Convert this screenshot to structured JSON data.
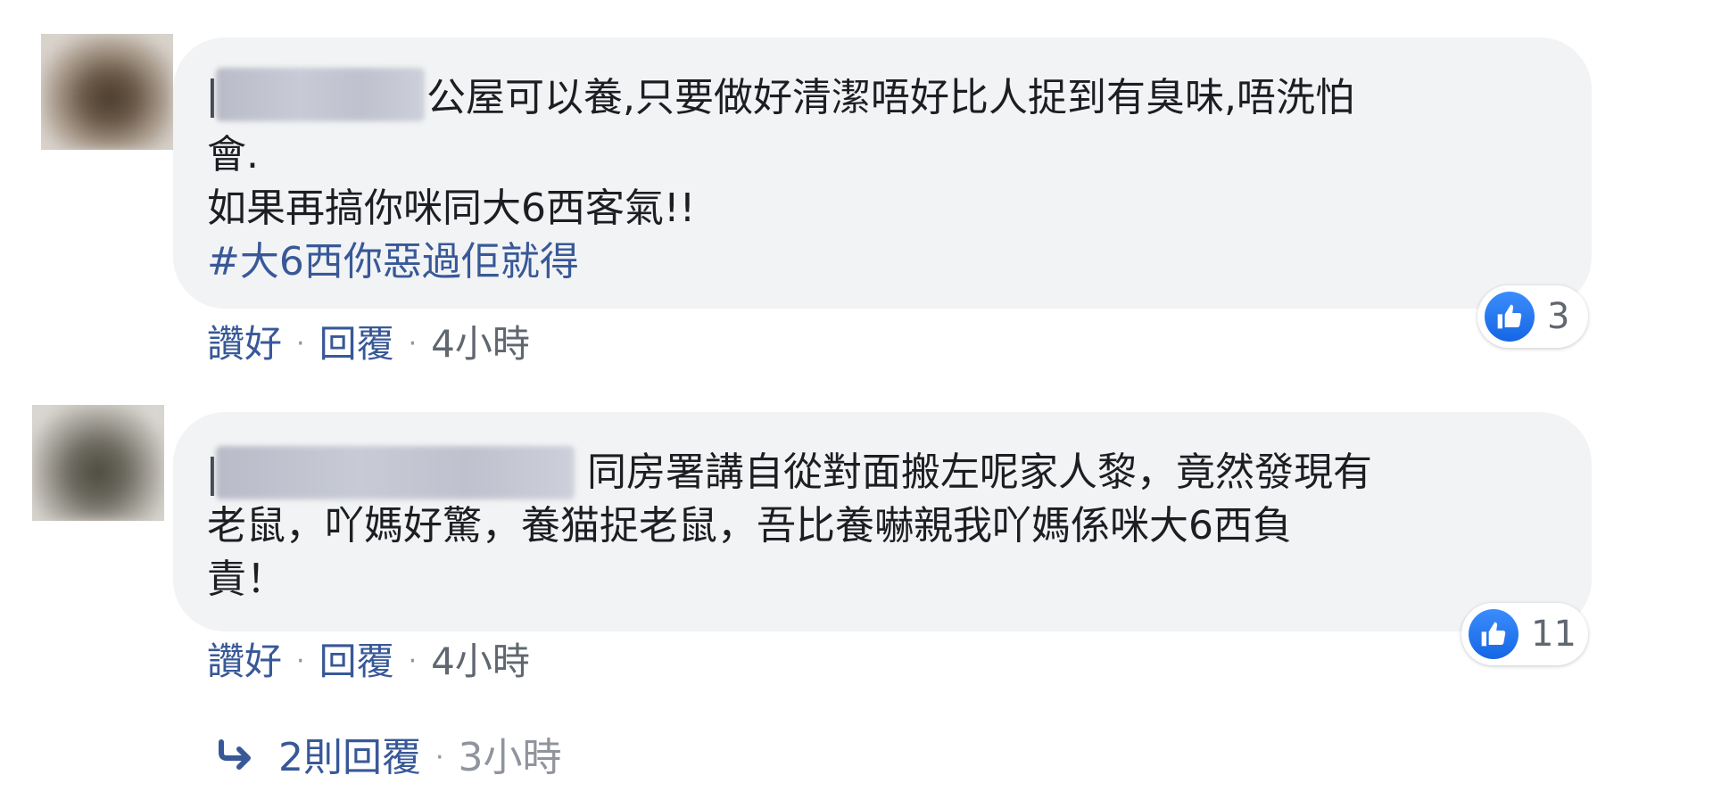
{
  "comments": [
    {
      "text_lines": [
        "公屋可以養,只要做好清潔唔好比人捉到有臭味,唔洗怕",
        "會.",
        "如果再搞你咪同大6西客氣!!"
      ],
      "hashtag": "#大6西你惡過佢就得",
      "reaction_count": "3",
      "actions": {
        "like": "讚好",
        "sep1": "·",
        "reply": "回覆",
        "sep2": "·",
        "time": "4小時"
      }
    },
    {
      "text_lines": [
        "同房署講自從對面搬左呢家人黎，竟然發現有",
        "老鼠，吖媽好驚，養猫捉老鼠，吾比養嚇親我吖媽係咪大6西負",
        "責！"
      ],
      "reaction_count": "11",
      "actions": {
        "like": "讚好",
        "sep1": "·",
        "reply": "回覆",
        "sep2": "·",
        "time": "4小時"
      }
    }
  ],
  "replies": {
    "label": "2則回覆",
    "sep": "·",
    "time": "3小時"
  },
  "icons": {
    "like": "thumbs-up-icon",
    "reply_arrow": "reply-arrow-icon"
  },
  "colors": {
    "bubble": "#f2f3f5",
    "link": "#385898",
    "like_blue": "#1877f2",
    "muted": "#606770"
  }
}
